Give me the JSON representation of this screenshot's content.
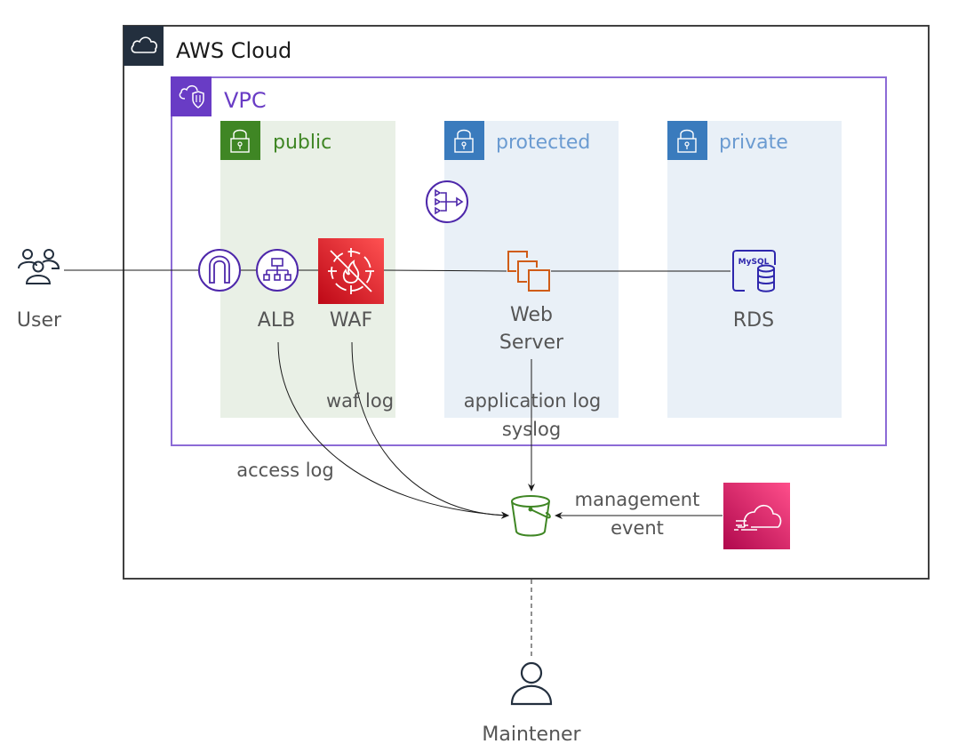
{
  "groups": {
    "aws_cloud": {
      "label": "AWS Cloud",
      "icon": "cloud-icon",
      "color": "#232f3e"
    },
    "vpc": {
      "label": "VPC",
      "icon": "vpc-cloud-shield-icon",
      "color": "#693cc5"
    },
    "subnets": [
      {
        "id": "public",
        "label": "public",
        "icon": "lock-icon",
        "color": "#3f8624",
        "text_color": "#3f8624",
        "fill": "#e9f0e6"
      },
      {
        "id": "protected",
        "label": "protected",
        "icon": "lock-icon",
        "color": "#3a7bbd",
        "text_color": "#6b9bd1",
        "fill": "#e9f0f7"
      },
      {
        "id": "private",
        "label": "private",
        "icon": "lock-icon",
        "color": "#3a7bbd",
        "text_color": "#6b9bd1",
        "fill": "#e9f0f7"
      }
    ]
  },
  "nodes": {
    "user": {
      "label": "User",
      "icon": "users-icon"
    },
    "igw": {
      "label": "",
      "icon": "internet-gateway-icon"
    },
    "alb": {
      "label": "ALB",
      "icon": "load-balancer-icon"
    },
    "waf": {
      "label": "WAF",
      "icon": "waf-icon",
      "color": "#dd344c"
    },
    "nat": {
      "label": "",
      "icon": "nat-gateway-icon"
    },
    "web": {
      "label_line1": "Web",
      "label_line2": "Server",
      "icon": "ec2-instances-icon",
      "color": "#d05c17"
    },
    "rds": {
      "label": "RDS",
      "icon": "rds-mysql-icon",
      "badge": "MySQL"
    },
    "s3": {
      "label": "",
      "icon": "s3-bucket-icon",
      "color": "#3f8624"
    },
    "cloudtrail": {
      "label": "",
      "icon": "cloudtrail-icon",
      "color": "#e7157b"
    },
    "maintener": {
      "label": "Maintener",
      "icon": "user-icon"
    }
  },
  "edges": {
    "waf_log": "waf log",
    "access_log": "access log",
    "app_log_line1": "application log",
    "app_log_line2": "syslog",
    "mgmt_line1": "management",
    "mgmt_line2": "event"
  }
}
